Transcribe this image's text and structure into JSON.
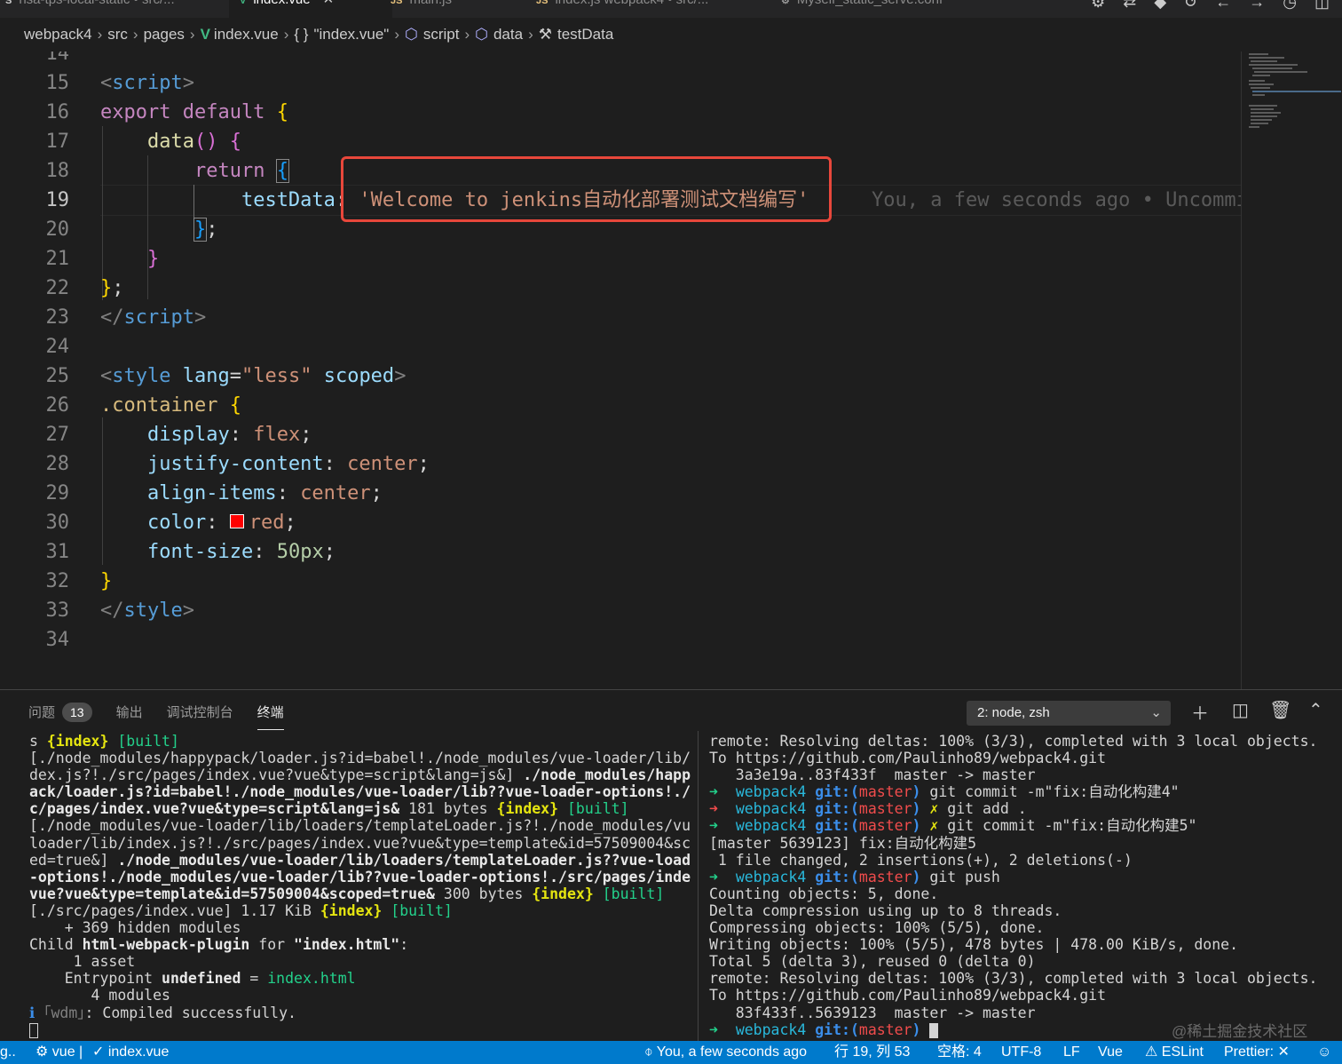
{
  "tabs": [
    {
      "icon": "S",
      "label": "nsa-tps-local-static • src/...",
      "active": false
    },
    {
      "icon": "V",
      "label": "index.vue",
      "active": true
    },
    {
      "icon": "JS",
      "label": "main.js",
      "active": false
    },
    {
      "icon": "JS",
      "label": "index.js  webpack4 • src/...",
      "active": false
    },
    {
      "icon": "⚙",
      "label": "Myself_static_serve.conf",
      "active": false
    }
  ],
  "breadcrumb": {
    "items": [
      "webpack4",
      "src",
      "pages",
      "index.vue",
      "\"index.vue\"",
      "script",
      "data",
      "testData"
    ],
    "object_glyph": "{ }"
  },
  "editor": {
    "line_numbers": [
      "14",
      "15",
      "16",
      "17",
      "18",
      "19",
      "20",
      "21",
      "22",
      "23",
      "24",
      "25",
      "26",
      "27",
      "28",
      "29",
      "30",
      "31",
      "32",
      "33",
      "34"
    ],
    "tokens": {
      "script_tag": "script",
      "export_default": "export default",
      "data_fn": "data",
      "return_kw": "return",
      "testData_key": "testData",
      "testData_value": "'Welcome to jenkins自动化部署测试文档编写'",
      "style_tag": "style",
      "lang_attr": "lang",
      "lang_value": "\"less\"",
      "scoped_attr": "scoped",
      "selector": ".container",
      "display_prop": "display",
      "display_value": "flex",
      "justify_prop": "justify-content",
      "justify_value": "center",
      "align_prop": "align-items",
      "align_value": "center",
      "color_prop": "color",
      "color_value": "red",
      "font_size_prop": "font-size",
      "font_size_value": "50px"
    },
    "blame": "You, a few seconds ago • Uncommi",
    "swatch_color": "#ff0000",
    "highlight_color": "#e8473b"
  },
  "panel": {
    "tabs": [
      {
        "label": "问题",
        "badge": "13"
      },
      {
        "label": "输出"
      },
      {
        "label": "调试控制台"
      },
      {
        "label": "终端",
        "active": true
      }
    ],
    "terminal_select": "2: node, zsh",
    "left_terminal": {
      "l1_pre": "s ",
      "l1_index": "{index}",
      "l1_built": " [built]",
      "l2": "[./node_modules/happypack/loader.js?id=babel!./node_modules/vue-loader/lib/in",
      "l3_pre": "dex.js?!./src/pages/index.vue?vue&type=script&lang=js&] ",
      "l3_bold": "./node_modules/happyp",
      "l4": "ack/loader.js?id=babel!./node_modules/vue-loader/lib??vue-loader-options!./sr",
      "l5_bold": "c/pages/index.vue?vue&type=script&lang=js&",
      "l5_mid": " 181 bytes ",
      "l5_index": "{index}",
      "l5_built": " [built]",
      "l6": "[./node_modules/vue-loader/lib/loaders/templateLoader.js?!./node_modules/vue-",
      "l7": "loader/lib/index.js?!./src/pages/index.vue?vue&type=template&id=57509004&scop",
      "l8_pre": "ed=true&] ",
      "l8_bold": "./node_modules/vue-loader/lib/loaders/templateLoader.js??vue-loader",
      "l9": "-options!./node_modules/vue-loader/lib??vue-loader-options!./src/pages/index.",
      "l10_bold": "vue?vue&type=template&id=57509004&scoped=true&",
      "l10_mid": " 300 bytes ",
      "l10_index": "{index}",
      "l10_built": " [built]",
      "l11_pre": "[./src/pages/index.vue] 1.17 KiB ",
      "l11_index": "{index}",
      "l11_built": " [built]",
      "l12": "    + 369 hidden modules",
      "l13_pre": "Child ",
      "l13_bold": "html-webpack-plugin",
      "l13_mid": " for ",
      "l13_bold2": "\"index.html\"",
      "l13_end": ":",
      "l14": "     1 asset",
      "l15_pre": "    Entrypoint ",
      "l15_bold": "undefined",
      "l15_mid": " = ",
      "l15_green": "index.html",
      "l16": "       4 modules",
      "l17_i": "ℹ",
      "l17_wdm": " ｢wdm｣",
      "l17_rest": ": Compiled successfully."
    },
    "right_terminal": {
      "r1": "remote: Resolving deltas: 100% (3/3), completed with 3 local objects.",
      "r2": "To https://github.com/Paulinho89/webpack4.git",
      "r3": "   3a3e19a..83f433f  master -> master",
      "prompt_arrow": "➜",
      "prompt_dir": "webpack4",
      "prompt_git": "git:(",
      "prompt_branch": "master",
      "prompt_close": ")",
      "dirty": "✗",
      "cmd1": " git commit -m\"fix:自动化构建4\"",
      "cmd2": " git add .",
      "cmd3": " git commit -m\"fix:自动化构建5\"",
      "r7": "[master 5639123] fix:自动化构建5",
      "r8": " 1 file changed, 2 insertions(+), 2 deletions(-)",
      "cmd4": " git push",
      "r10": "Counting objects: 5, done.",
      "r11": "Delta compression using up to 8 threads.",
      "r12": "Compressing objects: 100% (5/5), done.",
      "r13": "Writing objects: 100% (5/5), 478 bytes | 478.00 KiB/s, done.",
      "r14": "Total 5 (delta 3), reused 0 (delta 0)",
      "r15": "remote: Resolving deltas: 100% (3/3), completed with 3 local objects.",
      "r16": "To https://github.com/Paulinho89/webpack4.git",
      "r17": "   83f433f..5639123  master -> master"
    },
    "watermark": "@稀土掘金技术社区"
  },
  "statusbar": {
    "left_edge": "g..",
    "branch": "vue |",
    "check_file": "✓ index.vue",
    "blame": "You, a few seconds ago",
    "position": "行 19, 列 53",
    "spaces": "空格: 4",
    "encoding": "UTF-8",
    "eol": "LF",
    "language": "Vue",
    "eslint": "ESLint",
    "prettier": "Prettier: ✕",
    "bg_color": "#007acc"
  }
}
